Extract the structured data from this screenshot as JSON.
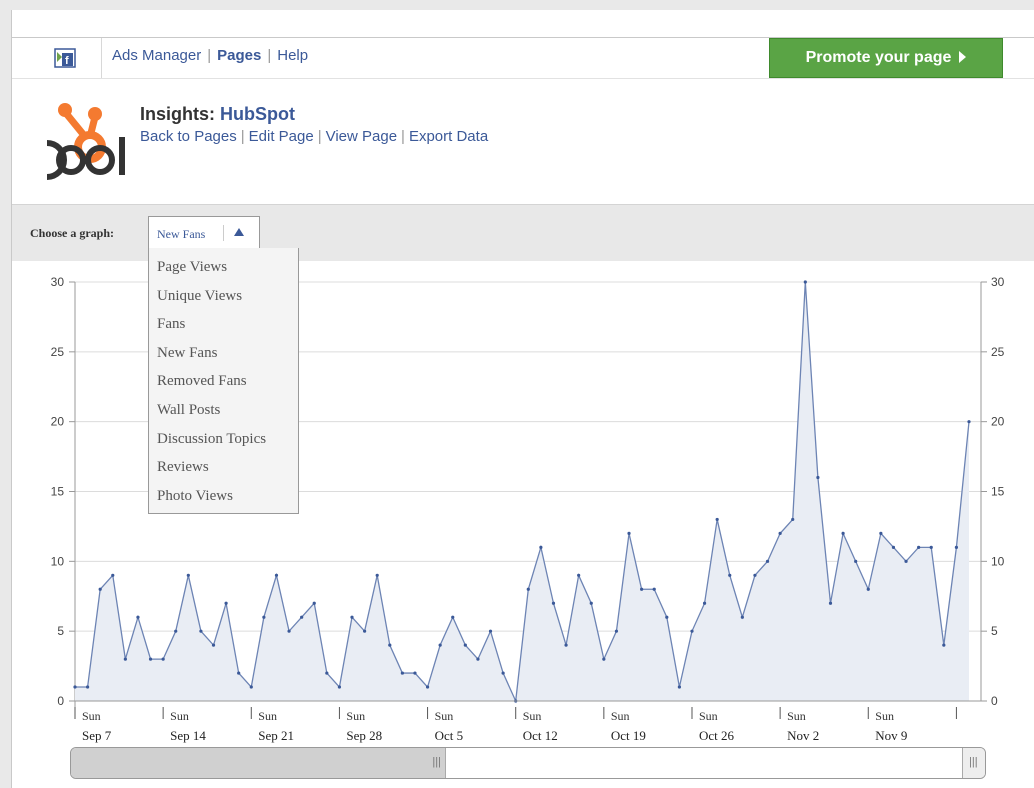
{
  "nav": {
    "links": [
      "Ads Manager",
      "Pages",
      "Help"
    ],
    "promote_label": "Promote your page"
  },
  "insights": {
    "prefix": "Insights:",
    "page_name": "HubSpot",
    "links": [
      "Back to Pages",
      "Edit Page",
      "View Page",
      "Export Data"
    ]
  },
  "graph_select": {
    "label": "Choose a graph:",
    "selected": "New Fans",
    "options": [
      "Page Views",
      "Unique Views",
      "Fans",
      "New Fans",
      "Removed Fans",
      "Wall Posts",
      "Discussion Topics",
      "Reviews",
      "Photo Views"
    ]
  },
  "chart_data": {
    "type": "area",
    "ylim": [
      0,
      30
    ],
    "yticks": [
      0,
      5,
      10,
      15,
      20,
      25,
      30
    ],
    "week_labels": [
      [
        "Sun",
        "Sep 7"
      ],
      [
        "Sun",
        "Sep 14"
      ],
      [
        "Sun",
        "Sep 21"
      ],
      [
        "Sun",
        "Sep 28"
      ],
      [
        "Sun",
        "Oct 5"
      ],
      [
        "Sun",
        "Oct 12"
      ],
      [
        "Sun",
        "Oct 19"
      ],
      [
        "Sun",
        "Oct 26"
      ],
      [
        "Sun",
        "Nov 2"
      ],
      [
        "Sun",
        "Nov 9"
      ]
    ],
    "values": [
      1,
      1,
      8,
      9,
      3,
      6,
      3,
      3,
      5,
      9,
      5,
      4,
      7,
      2,
      1,
      6,
      9,
      5,
      6,
      7,
      2,
      1,
      6,
      5,
      9,
      4,
      2,
      2,
      1,
      4,
      6,
      4,
      3,
      5,
      2,
      0,
      8,
      11,
      7,
      4,
      9,
      7,
      3,
      5,
      12,
      8,
      8,
      6,
      1,
      5,
      7,
      13,
      9,
      6,
      9,
      10,
      12,
      13,
      30,
      16,
      7,
      12,
      10,
      8,
      12,
      11,
      10,
      11,
      11,
      4,
      11,
      20
    ],
    "colors": {
      "line": "#6d84b4",
      "fill": "#e9edf4",
      "grid": "#dcdcdc"
    }
  },
  "scrollbar": {
    "grip": "|||"
  }
}
